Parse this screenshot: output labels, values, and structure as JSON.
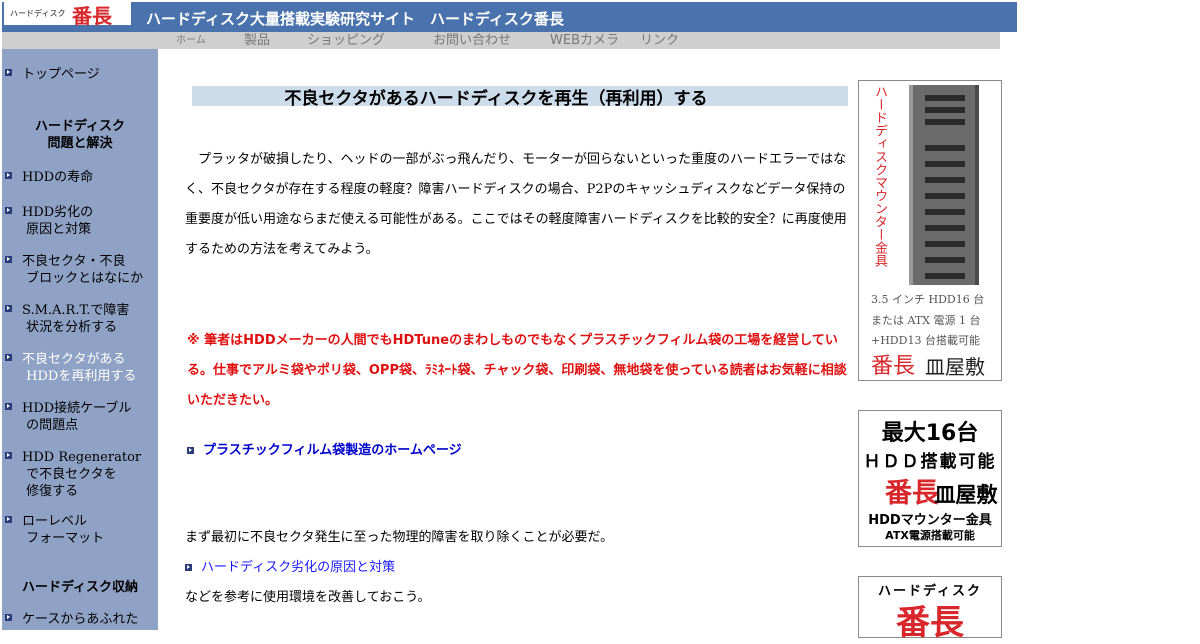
{
  "header": {
    "logo_small": "ハードディスク",
    "logo_big": "番長",
    "site_title": "ハードディスク大量搭載実験研究サイト　ハードディスク番長"
  },
  "nav": {
    "home": "ホーム",
    "products": "製品",
    "shopping": "ショッピング",
    "contact": "お問い合わせ",
    "webcam": "WEBカメラ",
    "links": "リンク"
  },
  "sidebar": {
    "top": "トップページ",
    "section1": "ハードディスク\n問題と解決",
    "items": [
      "HDDの寿命",
      "HDD劣化の\n 原因と対策",
      "不良セクタ・不良\n ブロックとはなにか",
      "S.M.A.R.T.で障害\n 状況を分析する",
      "不良セクタがある\n HDDを再利用する",
      "HDD接続ケーブル\n の問題点",
      "HDD Regenerator\n で不良セクタを\n 修復する",
      "ローレベル\n フォーマット"
    ],
    "section2": "ハードディスク収納",
    "last_item": "ケースからあふれた"
  },
  "main": {
    "title": "不良セクタがあるハードディスクを再生（再利用）する",
    "intro": "　プラッタが破損したり、ヘッドの一部がぶっ飛んだり、モーターが回らないといった重度のハードエラーではなく、不良セクタが存在する程度の軽度？障害ハードディスクの場合、P2Pのキャッシュディスクなどデータ保持の重要度が低い用途ならまだ使える可能性がある。ここではその軽度障害ハードディスクを比較的安全？に再度使用するための方法を考えてみよう。",
    "notice": "※ 筆者はHDDメーカーの人間でもHDTuneのまわしものでもなくプラスチックフィルム袋の工場を経営している。仕事でアルミ袋やポリ袋、OPP袋、ﾗﾐﾈｰﾄ袋、チャック袋、印刷袋、無地袋を使っている読者はお気軽に相談いただきたい。",
    "link1": "プラスチックフィルム袋製造のホームページ",
    "p2": "まず最初に不良セクタ発生に至った物理的障害を取り除くことが必要だ。",
    "link2": "ハードディスク劣化の原因と対策",
    "p3": "などを参考に使用環境を改善しておこう。"
  },
  "ads": {
    "ad1": {
      "vertical": "ハードディスクマウンター金具",
      "line1": "3.5 インチ HDD16 台",
      "line2": "または ATX 電源 1 台",
      "line3": "+HDD13 台搭載可能",
      "brand": "番長",
      "brand2": "皿屋敷"
    },
    "ad2": {
      "line1": "最大16台",
      "line2": "ＨＤＤ搭載可能",
      "brand": "番長",
      "brand2": "皿屋敷",
      "line3": "HDDマウンター金具",
      "line4": "ATX電源搭載可能"
    },
    "ad3": {
      "line1": "ハードディスク",
      "brand": "番長"
    }
  },
  "colors": {
    "header_bg": "#4a73ad",
    "sidebar_bg": "#8fa2c6",
    "navbar_bg": "#cfcfcf",
    "title_bar": "#cddcea",
    "notice_red": "#e01010",
    "brand_red": "#d8262b"
  }
}
